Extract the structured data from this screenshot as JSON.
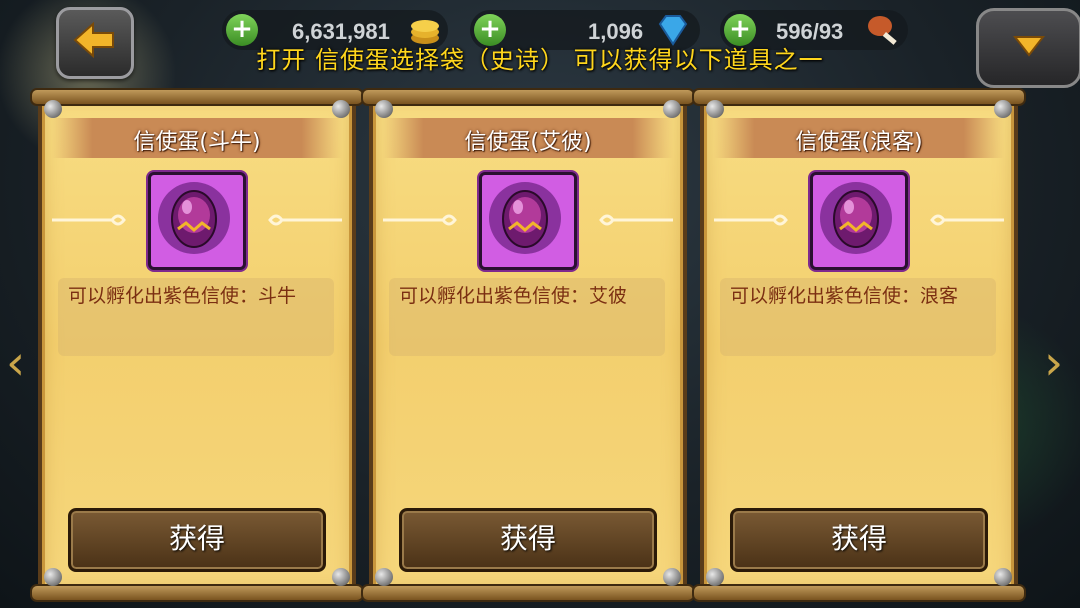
{
  "header": {
    "banner": "打开  信使蛋选择袋（史诗）  可以获得以下道具之一",
    "resources": [
      {
        "value": "6,631,981",
        "icon": "gold-coin-icon"
      },
      {
        "value": "1,096",
        "icon": "diamond-icon"
      },
      {
        "value": "596/93",
        "icon": "meat-icon"
      }
    ],
    "add_symbol": "+"
  },
  "nav": {
    "left_arrow": "‹",
    "right_arrow": "›"
  },
  "cards": [
    {
      "title": "信使蛋(斗牛)",
      "description": "可以孵化出紫色信使：斗牛",
      "button": "获得"
    },
    {
      "title": "信使蛋(艾彼)",
      "description": "可以孵化出紫色信使：艾彼",
      "button": "获得"
    },
    {
      "title": "信使蛋(浪客)",
      "description": "可以孵化出紫色信使：浪客",
      "button": "获得"
    }
  ],
  "colors": {
    "banner": "#ffd61c",
    "card_bg": "#f3cf6e",
    "description_text": "#7b2f12",
    "egg_frame": "#d15de3"
  }
}
